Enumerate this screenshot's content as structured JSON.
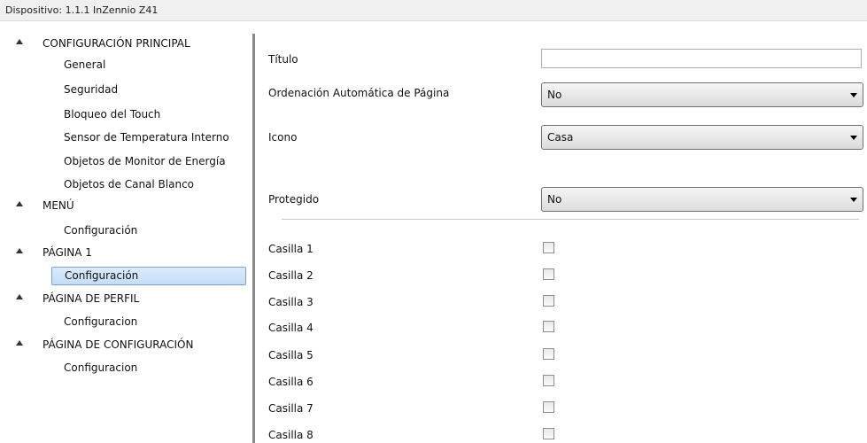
{
  "title_bar": {
    "text": "Dispositivo: 1.1.1  InZennio Z41"
  },
  "sidebar": {
    "sections": [
      {
        "label": "CONFIGURACIÓN PRINCIPAL",
        "children": [
          "General",
          "Seguridad",
          "Bloqueo del Touch",
          "Sensor de Temperatura Interno",
          "Objetos de Monitor de Energía",
          "Objetos de Canal Blanco"
        ]
      },
      {
        "label": "MENÚ",
        "children": [
          "Configuración"
        ]
      },
      {
        "label": "PÁGINA 1",
        "children": [
          "Configuración"
        ]
      },
      {
        "label": "PÁGINA DE PERFIL",
        "children": [
          "Configuracion"
        ]
      },
      {
        "label": "PÁGINA DE CONFIGURACIÓN",
        "children": [
          "Configuracion"
        ]
      }
    ],
    "selected": "PÁGINA 1 > Configuración"
  },
  "main": {
    "titulo": {
      "label": "Título",
      "value": ""
    },
    "ordenacion": {
      "label": "Ordenación Automática de Página",
      "value": "No"
    },
    "icono": {
      "label": "Icono",
      "value": "Casa"
    },
    "protegido": {
      "label": "Protegido",
      "value": "No"
    },
    "casillas": [
      {
        "label": "Casilla 1",
        "checked": false
      },
      {
        "label": "Casilla 2",
        "checked": false
      },
      {
        "label": "Casilla 3",
        "checked": false
      },
      {
        "label": "Casilla 4",
        "checked": false
      },
      {
        "label": "Casilla 5",
        "checked": false
      },
      {
        "label": "Casilla 6",
        "checked": false
      },
      {
        "label": "Casilla 7",
        "checked": false
      },
      {
        "label": "Casilla 8",
        "checked": false
      }
    ]
  }
}
